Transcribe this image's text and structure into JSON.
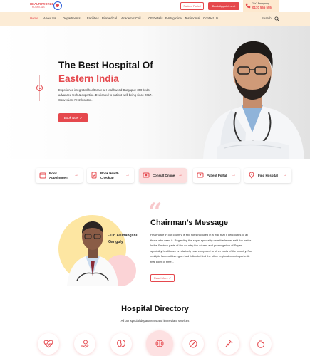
{
  "header": {
    "logo_text": "HEALTHWORLD",
    "logo_sub": "HOSPITALS",
    "patient_portal": "Patient Portal",
    "book_appointment": "Book Appointment",
    "emergency_label": "24x7 Emergency",
    "emergency_number": "0170 555 555"
  },
  "nav": {
    "items": [
      "Home",
      "About Us ⌄",
      "Departments ⌄",
      "Facilities",
      "Biomedical",
      "Academic Cell ⌄",
      "ICE Details",
      "E-Magazine",
      "Testimonial",
      "Contact Us"
    ],
    "search": "Search..."
  },
  "hero": {
    "title_line1": "The Best Hospital Of",
    "title_line2": "Eastern India",
    "description": "Experience integrated healthcare at Healthworld Durgapur: 300 beds, advanced tech & expertise. Dedicated to patient well-being since 2017. Convenient NH2 location.",
    "cta": "Book Now ↗"
  },
  "quick_links": [
    {
      "label": "Book Appointment"
    },
    {
      "label": "Book Health Checkup"
    },
    {
      "label": "Consult Online"
    },
    {
      "label": "Patient Portal"
    },
    {
      "label": "Find Hospital"
    }
  ],
  "quick_arrow": "→",
  "chairman": {
    "name_line1": "- Dr. Arunangshu",
    "name_line2": "Ganguly",
    "quote": "“",
    "title": "Chairman’s Message",
    "text": "Healthcare in our country is still not structured in a way that it percolates to all those who need it. Regarding the super speciality care the lesser said the better. In the Eastern parts of the country the advent and promulgation of Super-speciality healthcare is relatively new compared to other parts of the country. For multiple factors this region had fallen behind the other regional counterparts. At that point of time...",
    "read_more": "Read More ↗"
  },
  "directory": {
    "title": "Hospital Directory",
    "subtitle": "All our special departments and immediate services"
  },
  "colors": {
    "accent": "#e5484d",
    "nav_bg": "#fcecd6",
    "emergency_bg": "#fde9cf"
  }
}
